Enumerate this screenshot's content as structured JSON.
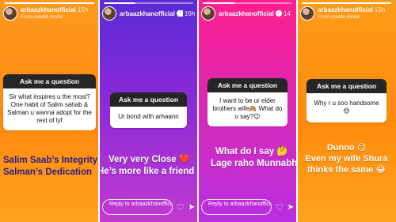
{
  "panels": [
    {
      "username": "arbaazkhanofficial",
      "time": "15h",
      "subtitle": "From create mode",
      "progress": 1.0,
      "question_header": "Ask me a question",
      "question": "Sir what inspires u the most? One habit of Salim sahab & Salman u wanna adopt for the rest of lyf",
      "answer_lines": [
        "Salim Saab’s Integrity",
        "Salman’s Dedication"
      ],
      "reply_placeholder": ""
    },
    {
      "username": "arbaazkhanofficial",
      "time": "15h",
      "subtitle": "",
      "progress": 0.35,
      "question_header": "Ask me a question",
      "question": "Ur bond with arhaann",
      "answer_lines": [
        "Very very Close ❤️",
        "He’s more like a friend 🤗"
      ],
      "reply_placeholder": "Reply to arbaazkhanofficial..."
    },
    {
      "username": "arbaazkhanofficial",
      "time": "14",
      "subtitle": "",
      "progress": 0.35,
      "question_header": "Ask me a question",
      "question": "I want to be ur elder brothers wife🙈 What do u say?😉",
      "answer_lines": [
        "What do I say 🤔",
        "Lage raho Munnabhai 😂"
      ],
      "reply_placeholder": "Reply to arbaazkhanofficial..."
    },
    {
      "username": "arbaazkhanofficial",
      "time": "15h",
      "subtitle": "From create mode",
      "progress": 1.0,
      "question_header": "Ask me a question",
      "question": "Why r u soo handsome 😍",
      "answer_lines": [
        "Dunno 😏",
        "Even my wife Shura",
        "thinks the same 😂"
      ],
      "reply_placeholder": ""
    }
  ],
  "icons": {
    "verified": "verified-badge-icon",
    "pause": "pause-icon",
    "mute": "mute-icon",
    "more": "more-icon",
    "heart": "heart-icon",
    "send": "send-icon"
  },
  "colors": {
    "orange_bg": "#ff8a10",
    "purple_bg": "#8a2ad8",
    "pink_bg": "#ff1f8e",
    "card_header": "#262626"
  }
}
